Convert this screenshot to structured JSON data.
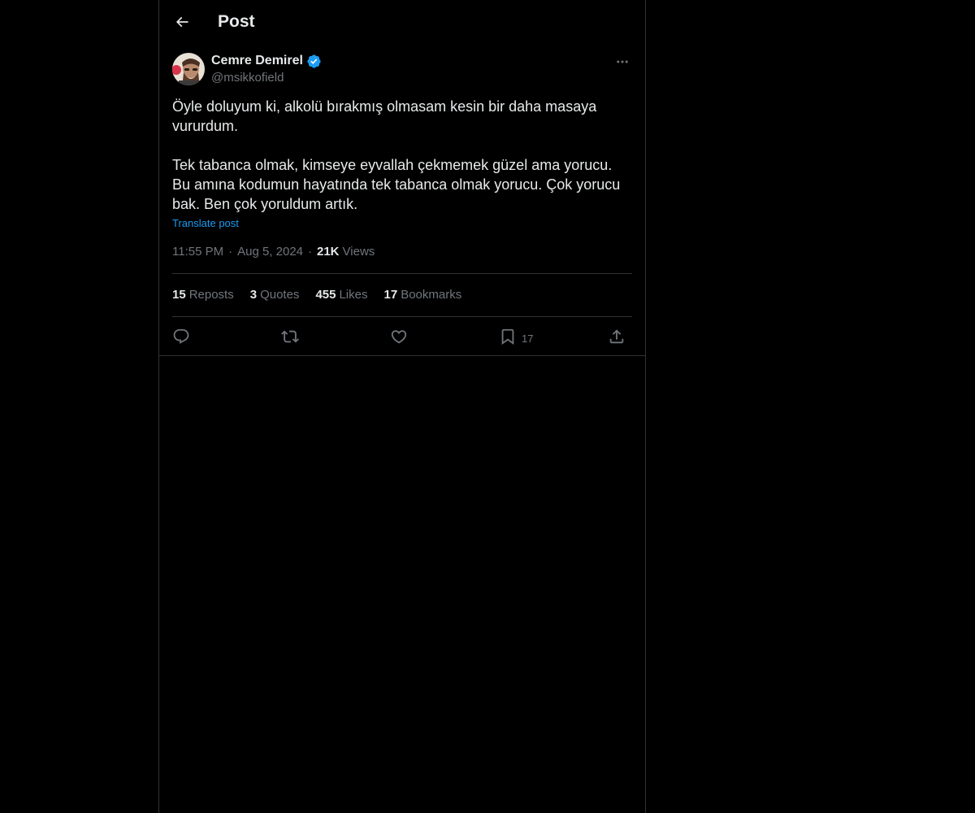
{
  "header": {
    "title": "Post",
    "back_icon": "arrow-left-icon"
  },
  "author": {
    "display_name": "Cemre Demirel",
    "handle": "@msikkofield",
    "verified_icon": "verified-badge-icon",
    "verified_color": "#1d9bf0"
  },
  "post": {
    "text": "Öyle doluyum ki, alkolü bırakmış olmasam kesin bir daha masaya vururdum.\n\nTek tabanca olmak, kimseye eyvallah çekmemek güzel ama yorucu. Bu amına kodumun hayatında tek tabanca olmak yorucu. Çok yorucu bak. Ben çok yoruldum artık.",
    "translate_label": "Translate post",
    "time": "11:55 PM",
    "date": "Aug 5, 2024",
    "views_count": "21K",
    "views_label": "Views"
  },
  "stats": [
    {
      "num": "15",
      "label": "Reposts"
    },
    {
      "num": "3",
      "label": "Quotes"
    },
    {
      "num": "455",
      "label": "Likes"
    },
    {
      "num": "17",
      "label": "Bookmarks"
    }
  ],
  "actions": {
    "reply_icon": "reply-icon",
    "repost_icon": "repost-icon",
    "like_icon": "heart-icon",
    "bookmark_icon": "bookmark-icon",
    "bookmark_count": "17",
    "share_icon": "share-icon"
  },
  "colors": {
    "background": "#000000",
    "text": "#e7e9ea",
    "muted": "#71767b",
    "accent": "#1d9bf0",
    "border": "#2f3336"
  }
}
